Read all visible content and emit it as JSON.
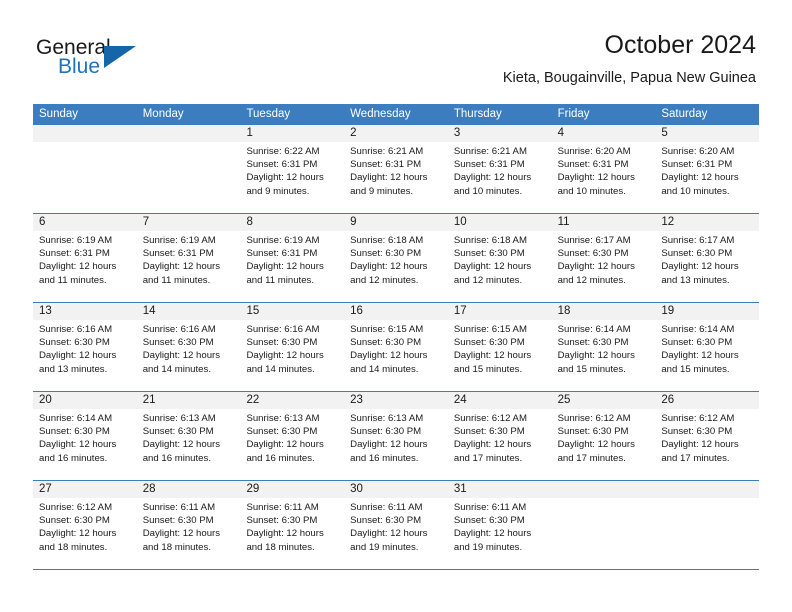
{
  "branding": {
    "logo_text_primary": "General",
    "logo_text_secondary": "Blue",
    "logo_icon": "triangle-icon",
    "accent_color": "#3b7dbf",
    "logo_blue": "#1f72bd"
  },
  "header": {
    "title": "October 2024",
    "subtitle": "Kieta, Bougainville, Papua New Guinea"
  },
  "weekdays": [
    "Sunday",
    "Monday",
    "Tuesday",
    "Wednesday",
    "Thursday",
    "Friday",
    "Saturday"
  ],
  "weeks": [
    [
      {
        "day": "",
        "sunrise": "",
        "sunset": "",
        "daylight_1": "",
        "daylight_2": ""
      },
      {
        "day": "",
        "sunrise": "",
        "sunset": "",
        "daylight_1": "",
        "daylight_2": ""
      },
      {
        "day": "1",
        "sunrise": "Sunrise: 6:22 AM",
        "sunset": "Sunset: 6:31 PM",
        "daylight_1": "Daylight: 12 hours",
        "daylight_2": "and 9 minutes."
      },
      {
        "day": "2",
        "sunrise": "Sunrise: 6:21 AM",
        "sunset": "Sunset: 6:31 PM",
        "daylight_1": "Daylight: 12 hours",
        "daylight_2": "and 9 minutes."
      },
      {
        "day": "3",
        "sunrise": "Sunrise: 6:21 AM",
        "sunset": "Sunset: 6:31 PM",
        "daylight_1": "Daylight: 12 hours",
        "daylight_2": "and 10 minutes."
      },
      {
        "day": "4",
        "sunrise": "Sunrise: 6:20 AM",
        "sunset": "Sunset: 6:31 PM",
        "daylight_1": "Daylight: 12 hours",
        "daylight_2": "and 10 minutes."
      },
      {
        "day": "5",
        "sunrise": "Sunrise: 6:20 AM",
        "sunset": "Sunset: 6:31 PM",
        "daylight_1": "Daylight: 12 hours",
        "daylight_2": "and 10 minutes."
      }
    ],
    [
      {
        "day": "6",
        "sunrise": "Sunrise: 6:19 AM",
        "sunset": "Sunset: 6:31 PM",
        "daylight_1": "Daylight: 12 hours",
        "daylight_2": "and 11 minutes."
      },
      {
        "day": "7",
        "sunrise": "Sunrise: 6:19 AM",
        "sunset": "Sunset: 6:31 PM",
        "daylight_1": "Daylight: 12 hours",
        "daylight_2": "and 11 minutes."
      },
      {
        "day": "8",
        "sunrise": "Sunrise: 6:19 AM",
        "sunset": "Sunset: 6:31 PM",
        "daylight_1": "Daylight: 12 hours",
        "daylight_2": "and 11 minutes."
      },
      {
        "day": "9",
        "sunrise": "Sunrise: 6:18 AM",
        "sunset": "Sunset: 6:30 PM",
        "daylight_1": "Daylight: 12 hours",
        "daylight_2": "and 12 minutes."
      },
      {
        "day": "10",
        "sunrise": "Sunrise: 6:18 AM",
        "sunset": "Sunset: 6:30 PM",
        "daylight_1": "Daylight: 12 hours",
        "daylight_2": "and 12 minutes."
      },
      {
        "day": "11",
        "sunrise": "Sunrise: 6:17 AM",
        "sunset": "Sunset: 6:30 PM",
        "daylight_1": "Daylight: 12 hours",
        "daylight_2": "and 12 minutes."
      },
      {
        "day": "12",
        "sunrise": "Sunrise: 6:17 AM",
        "sunset": "Sunset: 6:30 PM",
        "daylight_1": "Daylight: 12 hours",
        "daylight_2": "and 13 minutes."
      }
    ],
    [
      {
        "day": "13",
        "sunrise": "Sunrise: 6:16 AM",
        "sunset": "Sunset: 6:30 PM",
        "daylight_1": "Daylight: 12 hours",
        "daylight_2": "and 13 minutes."
      },
      {
        "day": "14",
        "sunrise": "Sunrise: 6:16 AM",
        "sunset": "Sunset: 6:30 PM",
        "daylight_1": "Daylight: 12 hours",
        "daylight_2": "and 14 minutes."
      },
      {
        "day": "15",
        "sunrise": "Sunrise: 6:16 AM",
        "sunset": "Sunset: 6:30 PM",
        "daylight_1": "Daylight: 12 hours",
        "daylight_2": "and 14 minutes."
      },
      {
        "day": "16",
        "sunrise": "Sunrise: 6:15 AM",
        "sunset": "Sunset: 6:30 PM",
        "daylight_1": "Daylight: 12 hours",
        "daylight_2": "and 14 minutes."
      },
      {
        "day": "17",
        "sunrise": "Sunrise: 6:15 AM",
        "sunset": "Sunset: 6:30 PM",
        "daylight_1": "Daylight: 12 hours",
        "daylight_2": "and 15 minutes."
      },
      {
        "day": "18",
        "sunrise": "Sunrise: 6:14 AM",
        "sunset": "Sunset: 6:30 PM",
        "daylight_1": "Daylight: 12 hours",
        "daylight_2": "and 15 minutes."
      },
      {
        "day": "19",
        "sunrise": "Sunrise: 6:14 AM",
        "sunset": "Sunset: 6:30 PM",
        "daylight_1": "Daylight: 12 hours",
        "daylight_2": "and 15 minutes."
      }
    ],
    [
      {
        "day": "20",
        "sunrise": "Sunrise: 6:14 AM",
        "sunset": "Sunset: 6:30 PM",
        "daylight_1": "Daylight: 12 hours",
        "daylight_2": "and 16 minutes."
      },
      {
        "day": "21",
        "sunrise": "Sunrise: 6:13 AM",
        "sunset": "Sunset: 6:30 PM",
        "daylight_1": "Daylight: 12 hours",
        "daylight_2": "and 16 minutes."
      },
      {
        "day": "22",
        "sunrise": "Sunrise: 6:13 AM",
        "sunset": "Sunset: 6:30 PM",
        "daylight_1": "Daylight: 12 hours",
        "daylight_2": "and 16 minutes."
      },
      {
        "day": "23",
        "sunrise": "Sunrise: 6:13 AM",
        "sunset": "Sunset: 6:30 PM",
        "daylight_1": "Daylight: 12 hours",
        "daylight_2": "and 16 minutes."
      },
      {
        "day": "24",
        "sunrise": "Sunrise: 6:12 AM",
        "sunset": "Sunset: 6:30 PM",
        "daylight_1": "Daylight: 12 hours",
        "daylight_2": "and 17 minutes."
      },
      {
        "day": "25",
        "sunrise": "Sunrise: 6:12 AM",
        "sunset": "Sunset: 6:30 PM",
        "daylight_1": "Daylight: 12 hours",
        "daylight_2": "and 17 minutes."
      },
      {
        "day": "26",
        "sunrise": "Sunrise: 6:12 AM",
        "sunset": "Sunset: 6:30 PM",
        "daylight_1": "Daylight: 12 hours",
        "daylight_2": "and 17 minutes."
      }
    ],
    [
      {
        "day": "27",
        "sunrise": "Sunrise: 6:12 AM",
        "sunset": "Sunset: 6:30 PM",
        "daylight_1": "Daylight: 12 hours",
        "daylight_2": "and 18 minutes."
      },
      {
        "day": "28",
        "sunrise": "Sunrise: 6:11 AM",
        "sunset": "Sunset: 6:30 PM",
        "daylight_1": "Daylight: 12 hours",
        "daylight_2": "and 18 minutes."
      },
      {
        "day": "29",
        "sunrise": "Sunrise: 6:11 AM",
        "sunset": "Sunset: 6:30 PM",
        "daylight_1": "Daylight: 12 hours",
        "daylight_2": "and 18 minutes."
      },
      {
        "day": "30",
        "sunrise": "Sunrise: 6:11 AM",
        "sunset": "Sunset: 6:30 PM",
        "daylight_1": "Daylight: 12 hours",
        "daylight_2": "and 19 minutes."
      },
      {
        "day": "31",
        "sunrise": "Sunrise: 6:11 AM",
        "sunset": "Sunset: 6:30 PM",
        "daylight_1": "Daylight: 12 hours",
        "daylight_2": "and 19 minutes."
      },
      {
        "day": "",
        "sunrise": "",
        "sunset": "",
        "daylight_1": "",
        "daylight_2": ""
      },
      {
        "day": "",
        "sunrise": "",
        "sunset": "",
        "daylight_1": "",
        "daylight_2": ""
      }
    ]
  ]
}
